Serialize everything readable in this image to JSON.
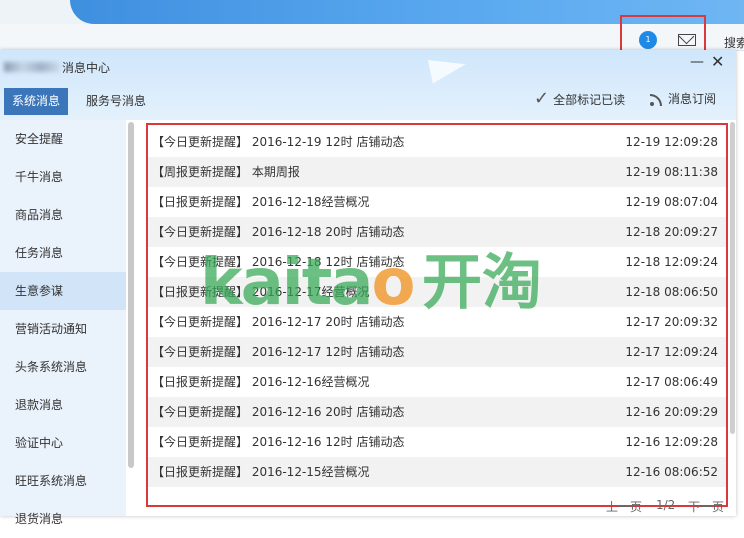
{
  "topbar": {
    "badge": "1",
    "search_label": "搜索"
  },
  "window": {
    "title": "消息中心",
    "tabs": [
      {
        "label": "系统消息",
        "active": true
      },
      {
        "label": "服务号消息",
        "active": false
      }
    ],
    "mark_all_read": "全部标记已读",
    "subscribe": "消息订阅"
  },
  "sidebar": {
    "items": [
      {
        "label": "安全提醒"
      },
      {
        "label": "千牛消息"
      },
      {
        "label": "商品消息"
      },
      {
        "label": "任务消息"
      },
      {
        "label": "生意参谋",
        "active": true
      },
      {
        "label": "营销活动通知"
      },
      {
        "label": "头条系统消息"
      },
      {
        "label": "退款消息"
      },
      {
        "label": "验证中心"
      },
      {
        "label": "旺旺系统消息"
      },
      {
        "label": "退货消息"
      }
    ]
  },
  "messages": [
    {
      "title": "【今日更新提醒】 2016-12-19 12时 店铺动态",
      "time": "12-19 12:09:28"
    },
    {
      "title": "【周报更新提醒】 本期周报",
      "time": "12-19 08:11:38"
    },
    {
      "title": "【日报更新提醒】 2016-12-18经营概况",
      "time": "12-19 08:07:04"
    },
    {
      "title": "【今日更新提醒】 2016-12-18 20时 店铺动态",
      "time": "12-18 20:09:27"
    },
    {
      "title": "【今日更新提醒】 2016-12-18 12时 店铺动态",
      "time": "12-18 12:09:24"
    },
    {
      "title": "【日报更新提醒】 2016-12-17经营概况",
      "time": "12-18 08:06:50"
    },
    {
      "title": "【今日更新提醒】 2016-12-17 20时 店铺动态",
      "time": "12-17 20:09:32"
    },
    {
      "title": "【今日更新提醒】 2016-12-17 12时 店铺动态",
      "time": "12-17 12:09:24"
    },
    {
      "title": "【日报更新提醒】 2016-12-16经营概况",
      "time": "12-17 08:06:49"
    },
    {
      "title": "【今日更新提醒】 2016-12-16 20时 店铺动态",
      "time": "12-16 20:09:29"
    },
    {
      "title": "【今日更新提醒】 2016-12-16 12时 店铺动态",
      "time": "12-16 12:09:28"
    },
    {
      "title": "【日报更新提醒】 2016-12-15经营概况",
      "time": "12-16 08:06:52"
    }
  ],
  "pager": {
    "prev": "上一页",
    "page": "1/2",
    "next": "下一页"
  },
  "watermark": {
    "latin": "kaitao",
    "cjk": "开淘"
  },
  "colors": {
    "highlight": "#d9393a",
    "tab_active": "#3c76ba",
    "sidebar_bg": "#eaf2fb"
  }
}
